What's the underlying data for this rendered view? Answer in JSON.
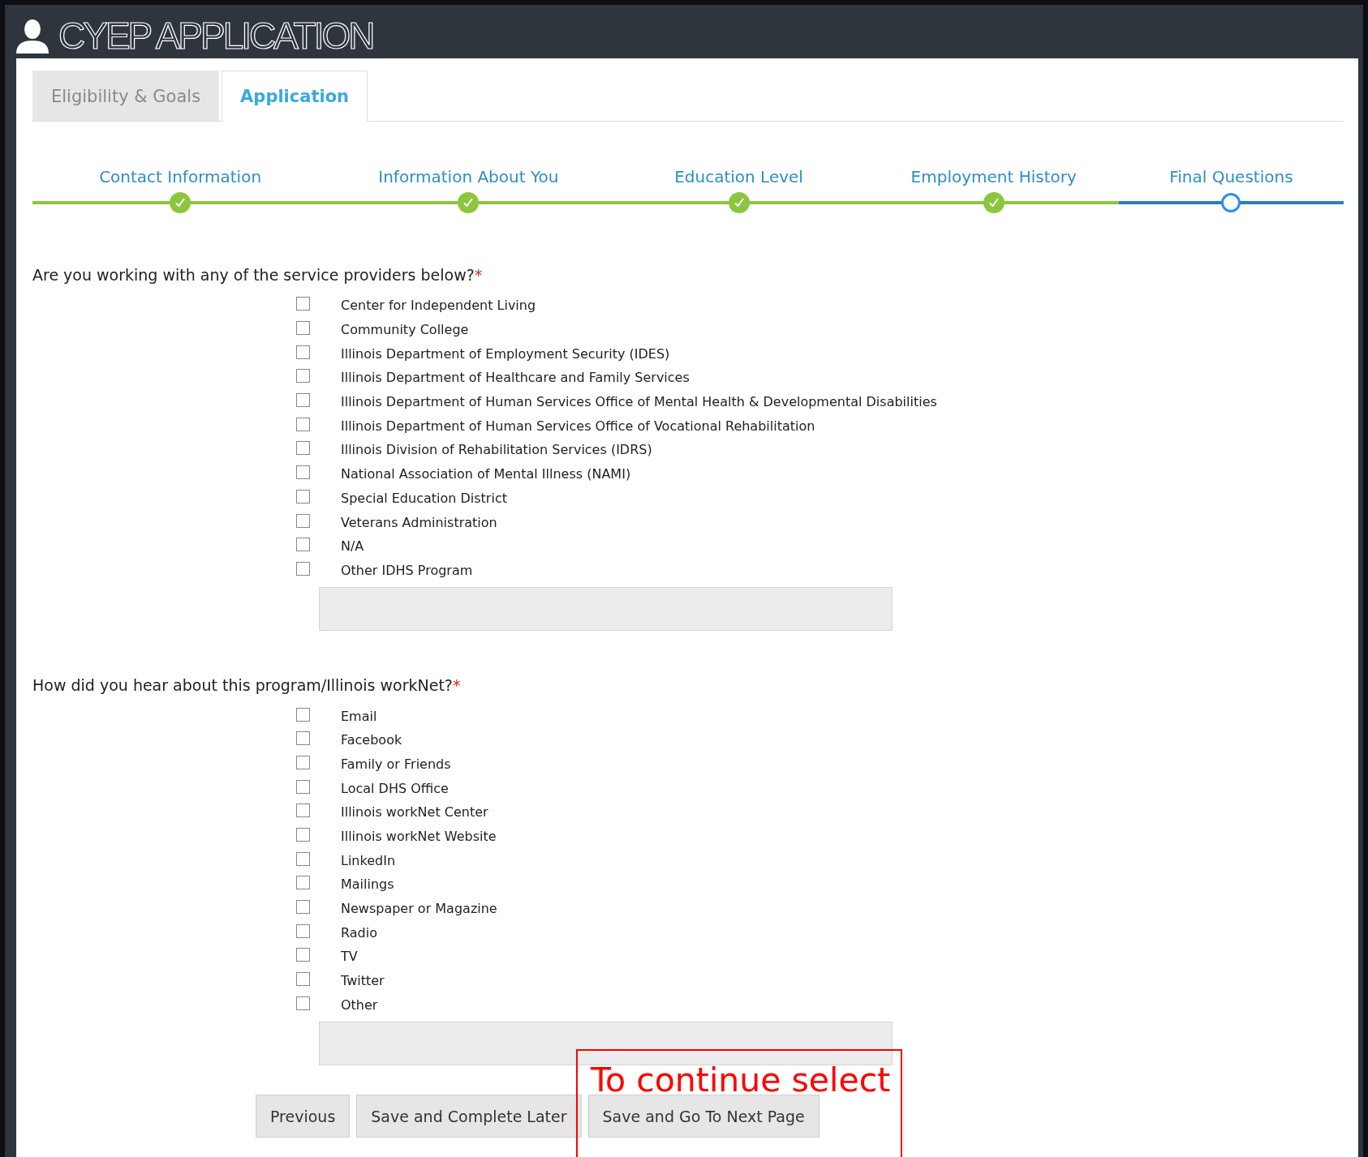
{
  "header": {
    "title": "CYEP APPLICATION"
  },
  "tabs": [
    {
      "label": "Eligibility & Goals",
      "selected": false
    },
    {
      "label": "Application",
      "selected": true
    }
  ],
  "steps": [
    {
      "label": "Contact Information",
      "complete": true
    },
    {
      "label": "Information About You",
      "complete": true
    },
    {
      "label": "Education Level",
      "complete": true
    },
    {
      "label": "Employment History",
      "complete": true
    },
    {
      "label": "Final Questions",
      "complete": false
    }
  ],
  "questions": [
    {
      "prompt": "Are you working with any of the service providers below?",
      "required_mark": "*",
      "options": [
        {
          "label": "Center for Independent Living",
          "checked": false
        },
        {
          "label": "Community College",
          "checked": false
        },
        {
          "label": "Illinois Department of Employment Security (IDES)",
          "checked": false
        },
        {
          "label": "Illinois Department of Healthcare and Family Services",
          "checked": false
        },
        {
          "label": "Illinois Department of Human Services Office of Mental Health & Developmental Disabilities",
          "checked": false
        },
        {
          "label": "Illinois Department of Human Services Office of Vocational Rehabilitation",
          "checked": false
        },
        {
          "label": "Illinois Division of Rehabilitation Services (IDRS)",
          "checked": false
        },
        {
          "label": "National Association of Mental Illness (NAMI)",
          "checked": false
        },
        {
          "label": "Special Education District",
          "checked": false
        },
        {
          "label": "Veterans Administration",
          "checked": false
        },
        {
          "label": "N/A",
          "checked": false
        },
        {
          "label": "Other IDHS Program",
          "checked": false
        }
      ]
    },
    {
      "prompt": "How did you hear about this program/Illinois workNet?",
      "required_mark": "*",
      "options": [
        {
          "label": "Email",
          "checked": false
        },
        {
          "label": "Facebook",
          "checked": false
        },
        {
          "label": "Family or Friends",
          "checked": false
        },
        {
          "label": "Local DHS Office",
          "checked": false
        },
        {
          "label": "Illinois workNet Center",
          "checked": false
        },
        {
          "label": "Illinois workNet Website",
          "checked": false
        },
        {
          "label": "LinkedIn",
          "checked": false
        },
        {
          "label": "Mailings",
          "checked": false
        },
        {
          "label": "Newspaper or Magazine",
          "checked": false
        },
        {
          "label": "Radio",
          "checked": false
        },
        {
          "label": "TV",
          "checked": false
        },
        {
          "label": "Twitter",
          "checked": false
        },
        {
          "label": "Other",
          "checked": false
        }
      ]
    }
  ],
  "buttons": [
    {
      "label": "Previous"
    },
    {
      "label": "Save and Complete Later"
    },
    {
      "label": "Save and Go To Next Page"
    }
  ],
  "annotation": {
    "text": "To continue select"
  }
}
